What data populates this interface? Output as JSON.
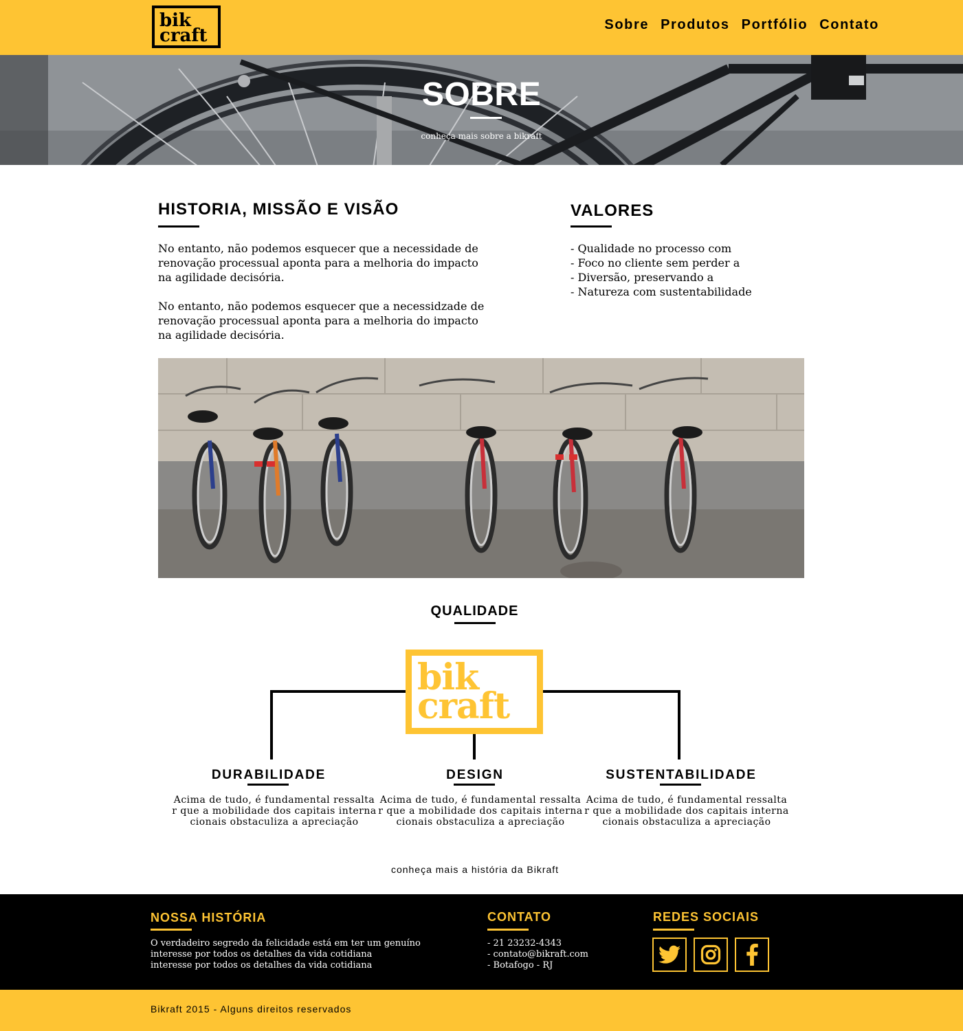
{
  "header": {
    "logo_line1": "bik",
    "logo_line2": "craft",
    "nav": [
      "Sobre",
      "Produtos",
      "Portfólio",
      "Contato"
    ]
  },
  "hero": {
    "title": "SOBRE",
    "subtitle": "conheça mais sobre a bikraft"
  },
  "historia": {
    "title": "HISTORIA, MISSÃO E VISÃO",
    "paragraphs": [
      "No entanto, não podemos esquecer que a necessidade de renovação processual aponta para a melhoria do impacto na agilidade decisória.",
      "No entanto, não podemos esquecer que a necessidzade de renovação processual aponta para a melhoria do impacto na agilidade decisória."
    ]
  },
  "valores": {
    "title": "VALORES",
    "items": [
      "- Qualidade no processo com",
      "- Foco no cliente sem perder a",
      "- Diversão, preservando a",
      "- Natureza com sustentabilidade"
    ]
  },
  "qualidade": {
    "title": "QUALIDADE",
    "logo_line1": "bik",
    "logo_line2": "craft",
    "columns": [
      {
        "title": "DURABILIDADE",
        "text": "Acima de tudo, é fundamental ressalta r que a mobilidade dos capitais interna cionais obstaculiza a apreciação"
      },
      {
        "title": "DESIGN",
        "text": "Acima de tudo, é fundamental ressalta r que a mobilidade dos capitais interna cionais obstaculiza a apreciação"
      },
      {
        "title": "SUSTENTABILIDADE",
        "text": "Acima de tudo, é fundamental ressalta r que a mobilidade dos capitais interna cionais obstaculiza a apreciação"
      }
    ],
    "more_link": "conheça mais a história da Bikraft"
  },
  "footer": {
    "historia_title": "NOSSA HISTÓRIA",
    "historia_text": "O verdadeiro segredo da felicidade está em ter um genuíno\ninteresse por todos os detalhes da vida cotidiana\ninteresse por todos os detalhes da vida cotidiana",
    "contato_title": "CONTATO",
    "contato_text": "- 21 23232-4343\n- contato@bikraft.com\n- Botafogo - RJ",
    "redes_title": "REDES SOCIAIS",
    "social_icons": [
      "twitter-icon",
      "instagram-icon",
      "facebook-icon"
    ],
    "copyright": "Bikraft 2015 - Alguns direitos reservados"
  },
  "colors": {
    "brand_yellow": "#FEC433",
    "black": "#000000",
    "white": "#FFFFFF"
  }
}
